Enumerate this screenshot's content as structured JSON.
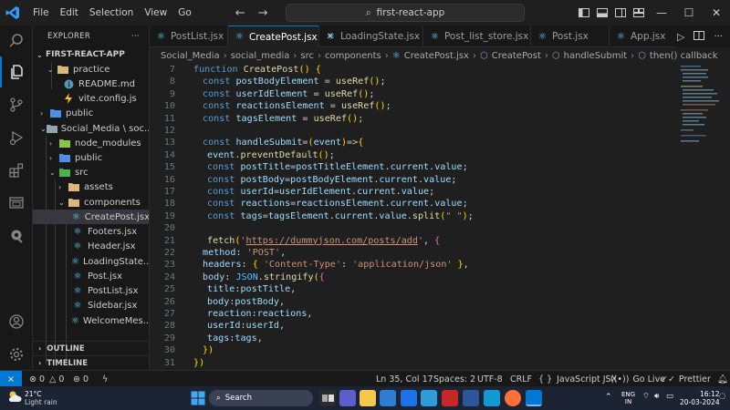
{
  "menu": [
    "File",
    "Edit",
    "Selection",
    "View",
    "Go"
  ],
  "search": {
    "text": "first-react-app"
  },
  "explorer": {
    "title": "EXPLORER",
    "root": "FIRST-REACT-APP",
    "items": [
      {
        "label": "practice",
        "icon": "folder-icon"
      },
      {
        "label": "README.md",
        "icon": "info-icon"
      },
      {
        "label": "vite.config.js",
        "icon": "lightning-icon"
      },
      {
        "label": "public",
        "icon": "folder-icon"
      },
      {
        "label": "Social_Media \\ soc...",
        "icon": "folder-icon"
      },
      {
        "label": "node_modules",
        "icon": "folder-icon"
      },
      {
        "label": "public",
        "icon": "folder-icon"
      },
      {
        "label": "src",
        "icon": "folder-icon"
      },
      {
        "label": "assets",
        "icon": "folder-icon"
      },
      {
        "label": "components",
        "icon": "folder-icon"
      },
      {
        "label": "CreatePost.jsx",
        "icon": "react-icon"
      },
      {
        "label": "Footers.jsx",
        "icon": "react-icon"
      },
      {
        "label": "Header.jsx",
        "icon": "react-icon"
      },
      {
        "label": "LoadingState....",
        "icon": "react-icon"
      },
      {
        "label": "Post.jsx",
        "icon": "react-icon"
      },
      {
        "label": "PostList.jsx",
        "icon": "react-icon"
      },
      {
        "label": "Sidebar.jsx",
        "icon": "react-icon"
      },
      {
        "label": "WelcomeMes...",
        "icon": "react-icon"
      }
    ],
    "outline": "OUTLINE",
    "timeline": "TIMELINE"
  },
  "tabs": [
    {
      "label": "PostList.jsx",
      "active": false
    },
    {
      "label": "CreatePost.jsx",
      "active": true
    },
    {
      "label": "LoadingState.jsx",
      "active": false
    },
    {
      "label": "Post_list_store.jsx",
      "active": false
    },
    {
      "label": "Post.jsx",
      "active": false
    },
    {
      "label": "App.jsx",
      "active": false
    }
  ],
  "breadcrumb": [
    "Social_Media",
    "social_media",
    "src",
    "components",
    "CreatePost.jsx",
    "CreatePost",
    "handleSubmit",
    "then() callback"
  ],
  "code": {
    "line_numbers": [
      "7",
      "8",
      "9",
      "10",
      "11",
      "12",
      "13",
      "14",
      "15",
      "16",
      "17",
      "18",
      "19",
      "20",
      "21",
      "22",
      "23",
      "24",
      "25",
      "26",
      "27",
      "28",
      "29",
      "30",
      "31"
    ],
    "lines": [
      "function CreatePost() {",
      "const postBodyElement = useRef();",
      "const userIdElement = useRef();",
      "const reactionsElement = useRef();",
      "const tagsElement = useRef();",
      "",
      "const handleSubmit=(event)=>{",
      "event.preventDefault();",
      "const postTitle=postTitleElement.current.value;",
      "const postBody=postBodyElement.current.value;",
      "const userId=userIdElement.current.value;",
      "const reactions=reactionsElement.current.value;",
      "const tags=tagsElement.current.value.split(\" \");",
      "",
      "fetch('https://dummyjson.com/posts/add', {",
      "method: 'POST',",
      "headers: { 'Content-Type': 'application/json' },",
      "body: JSON.stringify({",
      "title:postTitle,",
      "body:postBody,",
      "reaction:reactions,",
      "userId:userId,",
      "tags:tags,",
      "})",
      "})"
    ]
  },
  "status": {
    "problems_errors": "0",
    "problems_warnings": "0",
    "ports": "0",
    "position": "Ln 35, Col 17",
    "spaces": "Spaces: 2",
    "encoding": "UTF-8",
    "eol": "CRLF",
    "language": "JavaScript JSX",
    "golive": "Go Live",
    "prettier": "Prettier"
  },
  "taskbar": {
    "weather_temp": "21°C",
    "weather_desc": "Light rain",
    "search_label": "Search",
    "lang_top": "ENG",
    "lang_bottom": "IN",
    "time": "16:12",
    "date": "20-03-2024"
  },
  "colors": {
    "accent": "#0078d4",
    "react": "#61dafb",
    "keyword": "#569cd6",
    "function": "#dcdcaa",
    "variable": "#9cdcfe",
    "string": "#ce9178"
  }
}
